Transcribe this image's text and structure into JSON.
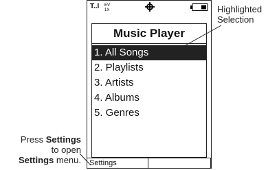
{
  "status_bar": {
    "signal_text": "T..l",
    "network_text": "EV\n1X",
    "icons": [
      "signal-icon",
      "network-type-icon",
      "gps-icon",
      "battery-icon"
    ]
  },
  "screen": {
    "title": "Music Player",
    "menu_items": [
      {
        "label": "1. All Songs",
        "selected": true
      },
      {
        "label": "2. Playlists",
        "selected": false
      },
      {
        "label": "3. Artists",
        "selected": false
      },
      {
        "label": "4. Albums",
        "selected": false
      },
      {
        "label": "5. Genres",
        "selected": false
      }
    ],
    "softkeys": {
      "left": "Settings",
      "right": ""
    }
  },
  "callouts": {
    "highlight": {
      "line1": "Highlighted",
      "line2": "Selection"
    },
    "settings": {
      "line1_prefix": "Press ",
      "line1_bold": "Settings",
      "line2": "to open",
      "line3_bold": "Settings",
      "line3_suffix": " menu."
    }
  },
  "colors": {
    "ink": "#222222",
    "highlight_bg": "#222222",
    "highlight_text": "#ffffff"
  }
}
